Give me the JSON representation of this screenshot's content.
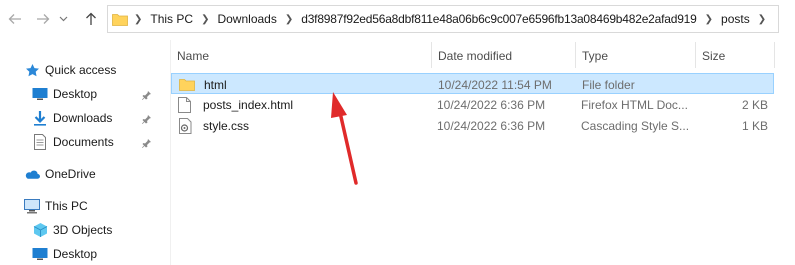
{
  "breadcrumb": {
    "items": [
      "This PC",
      "Downloads",
      "d3f8987f92ed56a8dbf811e48a06b6c9c007e6596fb13a08469b482e2afad919",
      "posts"
    ]
  },
  "columns": {
    "name": "Name",
    "date": "Date modified",
    "type": "Type",
    "size": "Size"
  },
  "files": [
    {
      "name": "html",
      "date": "10/24/2022 11:54 PM",
      "type": "File folder",
      "size": "",
      "icon": "folder-icon",
      "selected": true
    },
    {
      "name": "posts_index.html",
      "date": "10/24/2022 6:36 PM",
      "type": "Firefox HTML Doc...",
      "size": "2 KB",
      "icon": "html-file-icon",
      "selected": false
    },
    {
      "name": "style.css",
      "date": "10/24/2022 6:36 PM",
      "type": "Cascading Style S...",
      "size": "1 KB",
      "icon": "css-file-icon",
      "selected": false
    }
  ],
  "nav": {
    "quick_access": "Quick access",
    "desktop": "Desktop",
    "downloads": "Downloads",
    "documents": "Documents",
    "onedrive": "OneDrive",
    "this_pc": "This PC",
    "objects3d": "3D Objects",
    "desktop2": "Desktop"
  },
  "colors": {
    "selection": "#cce8ff",
    "selection_border": "#99d1ff",
    "folder": "#ffd35c",
    "accent": "#0078d7",
    "annotation_arrow": "#e02a2a"
  }
}
